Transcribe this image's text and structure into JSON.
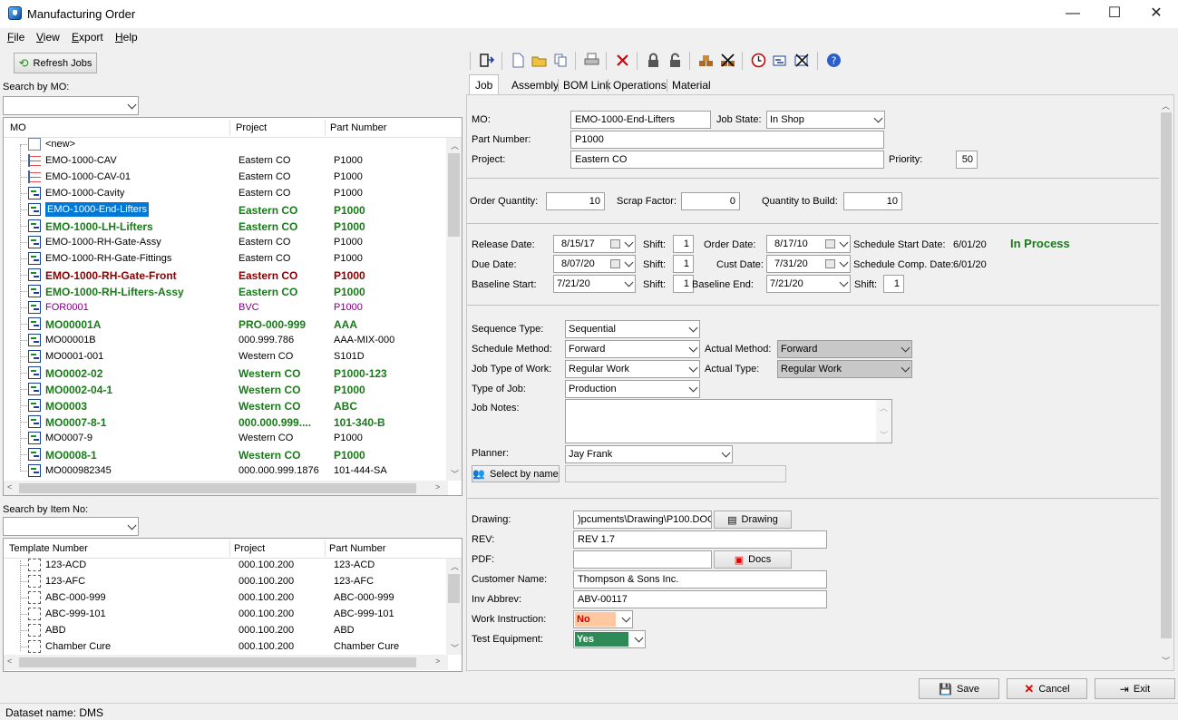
{
  "window": {
    "title": "Manufacturing Order",
    "minimize": "—",
    "maximize": "☐",
    "close": "✕"
  },
  "menu": [
    "File",
    "View",
    "Export",
    "Help"
  ],
  "left": {
    "refresh_label": "Refresh Jobs",
    "search_mo_label": "Search by MO:",
    "search_item_label": "Search by Item No:",
    "mo_grid": {
      "headers": [
        "MO",
        "Project",
        "Part Number"
      ],
      "rows": [
        {
          "mo": "<new>",
          "project": "",
          "part": "",
          "style": "normal",
          "icon": "new"
        },
        {
          "mo": "EMO-1000-CAV",
          "project": "Eastern CO",
          "part": "P1000",
          "style": "normal",
          "icon": "list"
        },
        {
          "mo": "EMO-1000-CAV-01",
          "project": "Eastern CO",
          "part": "P1000",
          "style": "normal",
          "icon": "list"
        },
        {
          "mo": "EMO-1000-Cavity",
          "project": "Eastern CO",
          "part": "P1000",
          "style": "normal",
          "icon": "gantt"
        },
        {
          "mo": "EMO-1000-End-Lifters",
          "project": "Eastern CO",
          "part": "P1000",
          "style": "green",
          "icon": "gantt"
        },
        {
          "mo": "EMO-1000-LH-Lifters",
          "project": "Eastern CO",
          "part": "P1000",
          "style": "green",
          "icon": "gantt"
        },
        {
          "mo": "EMO-1000-RH-Gate-Assy",
          "project": "Eastern CO",
          "part": "P1000",
          "style": "normal",
          "icon": "gantt"
        },
        {
          "mo": "EMO-1000-RH-Gate-Fittings",
          "project": "Eastern CO",
          "part": "P1000",
          "style": "normal",
          "icon": "gantt"
        },
        {
          "mo": "EMO-1000-RH-Gate-Front",
          "project": "Eastern CO",
          "part": "P1000",
          "style": "red",
          "icon": "gantt"
        },
        {
          "mo": "EMO-1000-RH-Lifters-Assy",
          "project": "Eastern CO",
          "part": "P1000",
          "style": "green",
          "icon": "gantt"
        },
        {
          "mo": "FOR0001",
          "project": "BVC",
          "part": "P1000",
          "style": "purple",
          "icon": "gantt"
        },
        {
          "mo": "MO00001A",
          "project": "PRO-000-999",
          "part": "AAA",
          "style": "green",
          "icon": "gantt"
        },
        {
          "mo": "MO00001B",
          "project": "000.999.786",
          "part": "AAA-MIX-000",
          "style": "normal",
          "icon": "gantt"
        },
        {
          "mo": "MO0001-001",
          "project": "Western CO",
          "part": "S101D",
          "style": "normal",
          "icon": "gantt"
        },
        {
          "mo": "MO0002-02",
          "project": "Western CO",
          "part": "P1000-123",
          "style": "green",
          "icon": "gantt"
        },
        {
          "mo": "MO0002-04-1",
          "project": "Western CO",
          "part": "P1000",
          "style": "green",
          "icon": "gantt"
        },
        {
          "mo": "MO0003",
          "project": "Western CO",
          "part": "ABC",
          "style": "green",
          "icon": "gantt"
        },
        {
          "mo": "MO0007-8-1",
          "project": "000.000.999....",
          "part": "101-340-B",
          "style": "green",
          "icon": "gantt"
        },
        {
          "mo": "MO0007-9",
          "project": "Western CO",
          "part": "P1000",
          "style": "normal",
          "icon": "gantt"
        },
        {
          "mo": "MO0008-1",
          "project": "Western CO",
          "part": "P1000",
          "style": "green",
          "icon": "gantt"
        },
        {
          "mo": "MO000982345",
          "project": "000.000.999.1876",
          "part": "101-444-SA",
          "style": "normal",
          "icon": "gantt"
        }
      ]
    },
    "tpl_grid": {
      "headers": [
        "Template Number",
        "Project",
        "Part Number"
      ],
      "rows": [
        {
          "tpl": "123-ACD",
          "project": "000.100.200",
          "part": "123-ACD"
        },
        {
          "tpl": "123-AFC",
          "project": "000.100.200",
          "part": "123-AFC"
        },
        {
          "tpl": "ABC-000-999",
          "project": "000.100.200",
          "part": "ABC-000-999"
        },
        {
          "tpl": "ABC-999-101",
          "project": "000.100.200",
          "part": "ABC-999-101"
        },
        {
          "tpl": "ABD",
          "project": "000.100.200",
          "part": "ABD"
        },
        {
          "tpl": "Chamber Cure",
          "project": "000.100.200",
          "part": "Chamber Cure"
        }
      ]
    }
  },
  "tabs": [
    "Job",
    "Assembly",
    "BOM Link",
    "Operations",
    "Material"
  ],
  "form": {
    "mo_label": "MO:",
    "mo": "EMO-1000-End-Lifters",
    "job_state_label": "Job State:",
    "job_state": "In Shop",
    "part_label": "Part Number:",
    "part": "P1000",
    "project_label": "Project:",
    "project": "Eastern CO",
    "priority_label": "Priority:",
    "priority": "50",
    "order_qty_label": "Order Quantity:",
    "order_qty": "10",
    "scrap_label": "Scrap Factor:",
    "scrap": "0",
    "qty_build_label": "Quantity to Build:",
    "qty_build": "10",
    "release_label": "Release Date:",
    "release": "8/15/17",
    "due_label": "Due Date:",
    "due": "8/07/20",
    "baseline_start_label": "Baseline Start:",
    "baseline_start": "7/21/20",
    "shift_label": "Shift:",
    "shift1": "1",
    "shift2": "1",
    "shift3": "1",
    "shift4": "1",
    "order_date_label": "Order Date:",
    "order_date": "8/17/10",
    "cust_date_label": "Cust Date:",
    "cust_date": "7/31/20",
    "baseline_end_label": "Baseline End:",
    "baseline_end": "7/21/20",
    "sched_start_label": "Schedule Start Date:",
    "sched_start": "6/01/20",
    "sched_comp_label": "Schedule Comp. Date:",
    "sched_comp": "6/01/20",
    "status": "In Process",
    "seq_type_label": "Sequence Type:",
    "seq_type": "Sequential",
    "sched_method_label": "Schedule Method:",
    "sched_method": "Forward",
    "actual_method_label": "Actual Method:",
    "actual_method": "Forward",
    "job_type_work_label": "Job Type of Work:",
    "job_type_work": "Regular Work",
    "actual_type_label": "Actual Type:",
    "actual_type": "Regular Work",
    "type_job_label": "Type of Job:",
    "type_job": "Production",
    "notes_label": "Job Notes:",
    "notes": "",
    "planner_label": "Planner:",
    "planner": "Jay Frank",
    "select_name_label": "Select by name",
    "drawing_label": "Drawing:",
    "drawing": ")pcuments\\Drawing\\P100.DOC",
    "drawing_btn": "Drawing",
    "rev_label": "REV:",
    "rev": "REV 1.7",
    "pdf_label": "PDF:",
    "pdf": "",
    "docs_btn": "Docs",
    "customer_label": "Customer Name:",
    "customer": "Thompson & Sons Inc.",
    "inv_label": "Inv Abbrev:",
    "inv": "ABV-00117",
    "work_instr_label": "Work Instruction:",
    "work_instr": "No",
    "test_eq_label": "Test Equipment:",
    "test_eq": "Yes"
  },
  "buttons": {
    "save": "Save",
    "cancel": "Cancel",
    "exit": "Exit"
  },
  "colors": {
    "no_bg": "#ffc8a0",
    "no_fg": "#cc0000",
    "yes_bg": "#2e8b57",
    "yes_fg": "#ffffff"
  },
  "status_bar": "Dataset name:  DMS"
}
